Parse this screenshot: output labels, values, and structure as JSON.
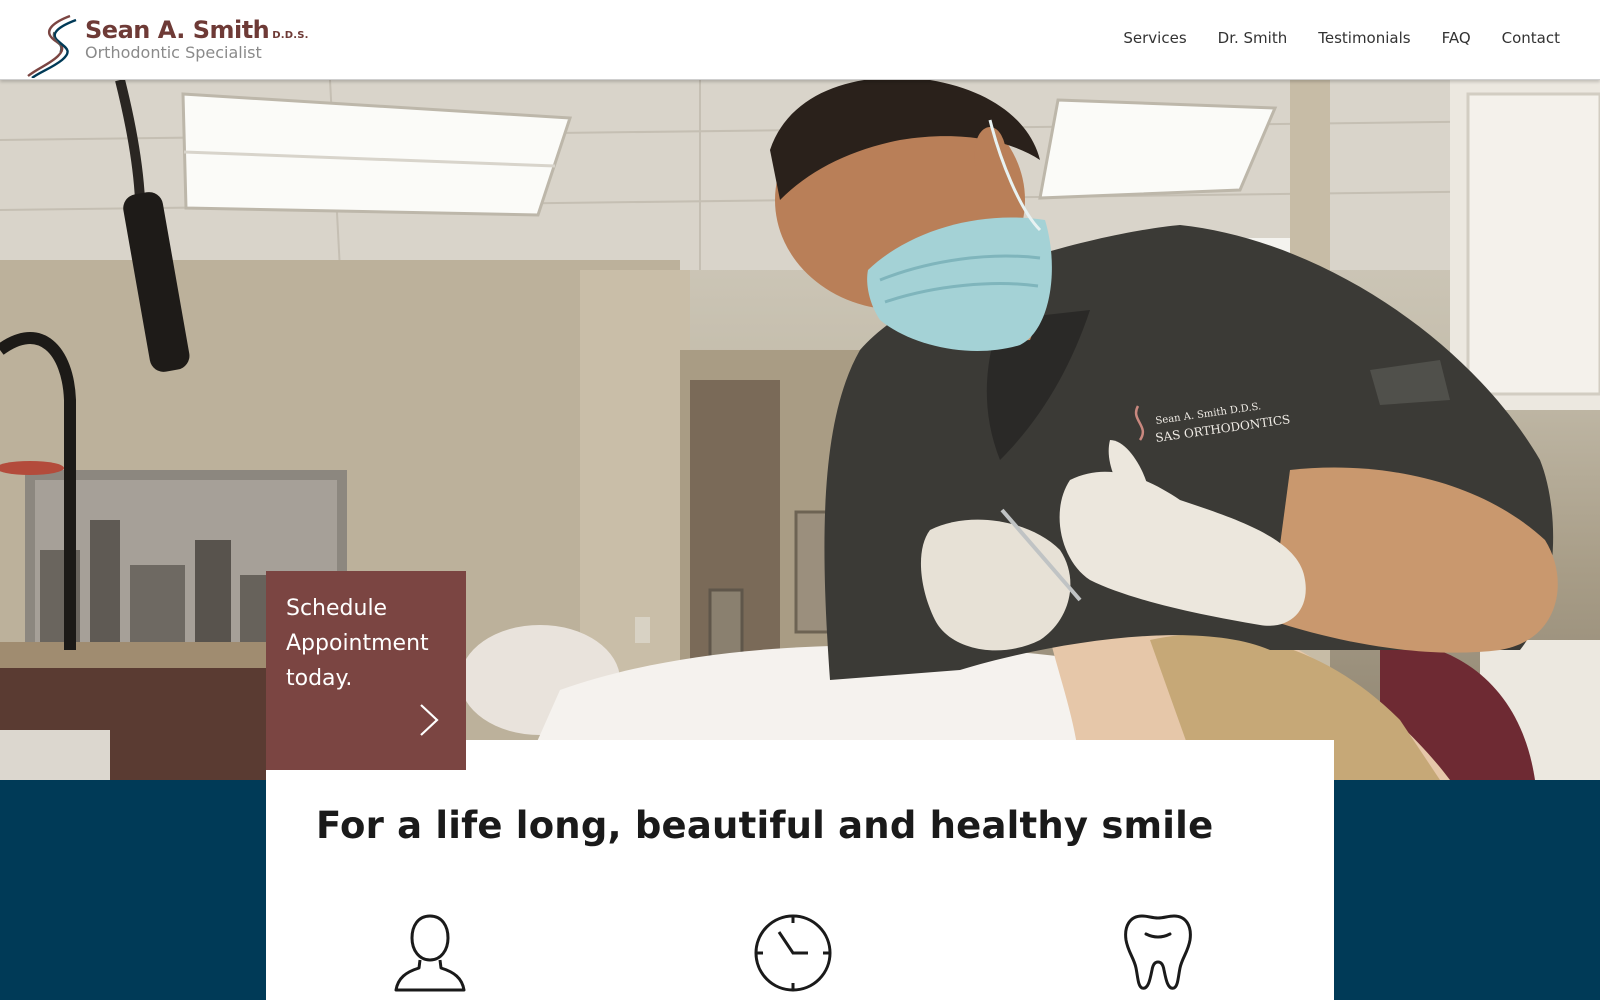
{
  "brand": {
    "name": "Sean A. Smith",
    "credential": "D.D.S.",
    "tagline": "Orthodontic Specialist",
    "primary_color": "#7b4542",
    "navy_color": "#003a57"
  },
  "nav": {
    "items": [
      "Services",
      "Dr. Smith",
      "Testimonials",
      "FAQ",
      "Contact"
    ]
  },
  "hero": {
    "scrubs_embroidery": [
      "Sean A. Smith D.D.S.",
      "SAS ORTHODONTICS"
    ]
  },
  "cta": {
    "lines": [
      "Schedule",
      "Appointment",
      "today."
    ],
    "arrow_icon": "chevron-right-icon"
  },
  "intro": {
    "title": "For a life long, beautiful and healthy smile",
    "icons": [
      "user-icon",
      "clock-icon",
      "tooth-icon"
    ]
  }
}
